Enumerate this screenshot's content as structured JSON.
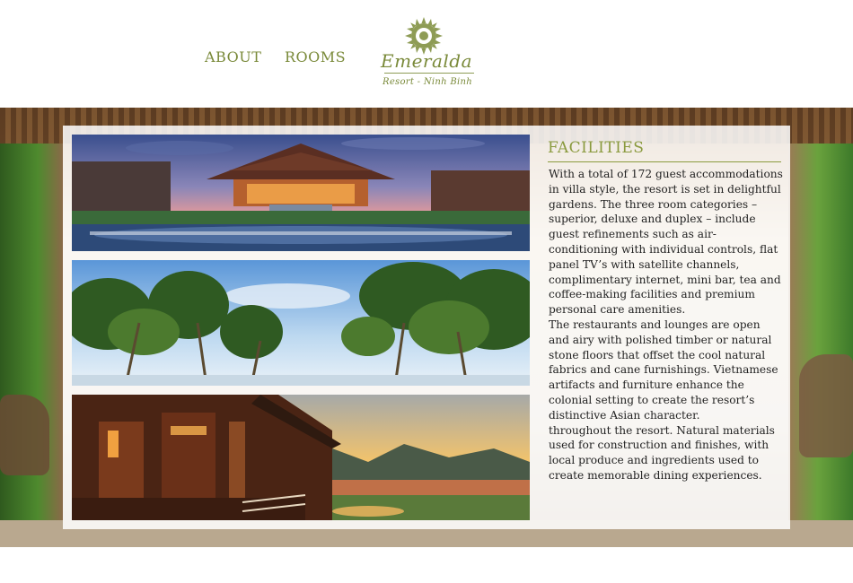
{
  "nav": {
    "about_label": "ABOUT",
    "rooms_label": "ROOMS"
  },
  "logo": {
    "name": "Emeralda",
    "tagline": "Resort - Ninh Binh",
    "emblem_icon": "sun-ring-icon"
  },
  "facilities": {
    "title": "FACILITIES",
    "paragraphs": [
      "With a total of 172 guest accommodations in villa style, the resort is set in delightful gardens. The three room categories – superior, deluxe and duplex – include guest refinements such as air-conditioning with individual controls, flat panel TV’s with satellite channels, complimentary internet, mini bar, tea and coffee-making facilities and premium personal care amenities.",
      "The restaurants and lounges are open and airy with polished timber or natural stone floors that offset the cool natural fabrics and cane furnishings. Vietnamese artifacts and furniture enhance the colonial setting to create the resort’s distinctive Asian character.",
      "throughout the resort. Natural materials used for construction and finishes, with local produce and ingredients used to create memorable dining experiences."
    ]
  },
  "colors": {
    "accent_olive": "#7a8a3a",
    "title_olive": "#8a9a3e",
    "body_text": "#222222"
  }
}
